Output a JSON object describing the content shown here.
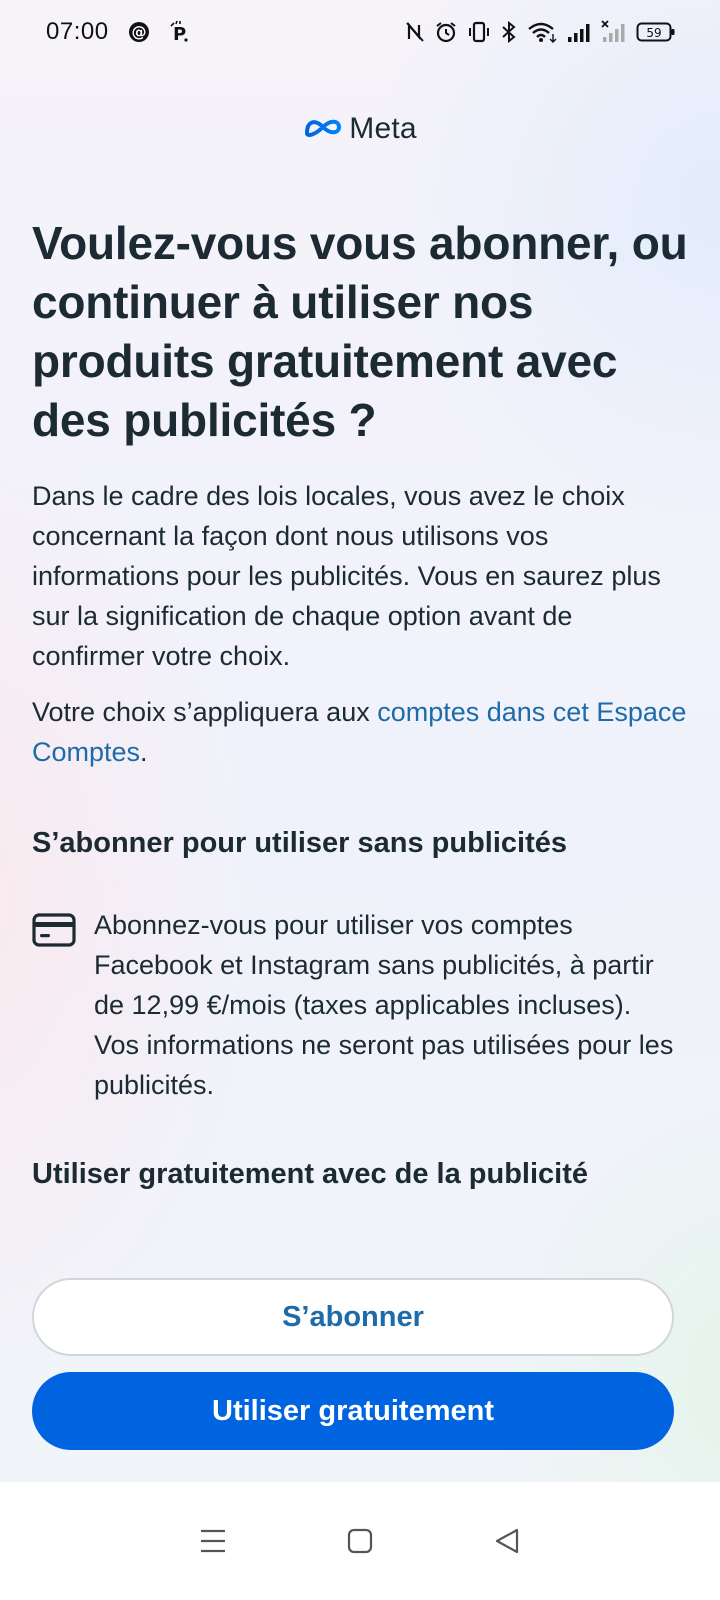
{
  "status_bar": {
    "time": "07:00",
    "battery": "59",
    "icons": [
      "threads-icon",
      "parking-icon",
      "nfc-off-icon",
      "alarm-icon",
      "vibrate-icon",
      "bluetooth-icon",
      "wifi-icon",
      "signal-icon",
      "signal-no-service-icon",
      "battery-icon"
    ]
  },
  "brand": {
    "name": "Meta"
  },
  "headline": "Voulez-vous vous abonner, ou continuer à utiliser nos produits gratuitement avec des publicités ?",
  "intro": "Dans le cadre des lois locales, vous avez le choix concernant la façon dont nous utilisons vos informations pour les publicités. Vous en saurez plus sur la signification de chaque option avant de confirmer votre choix.",
  "scope": {
    "prefix": "Votre choix s’appliquera aux ",
    "link": "comptes dans cet Espace Comptes",
    "suffix": "."
  },
  "subscribe_section": {
    "title": "S’abonner pour utiliser sans publicités",
    "icon": "credit-card-icon",
    "description": "Abonnez-vous pour utiliser vos comptes Facebook et Instagram sans publicités, à partir de 12,99 €/mois (taxes applicables incluses). Vos informations ne seront pas utilisées pour les publicités."
  },
  "free_section": {
    "title": "Utiliser gratuitement avec de la publicité"
  },
  "buttons": {
    "subscribe": "S’abonner",
    "free": "Utiliser gratuitement"
  },
  "colors": {
    "primary": "#0064e0",
    "link": "#1d6ba8",
    "text": "#1c2b33"
  }
}
